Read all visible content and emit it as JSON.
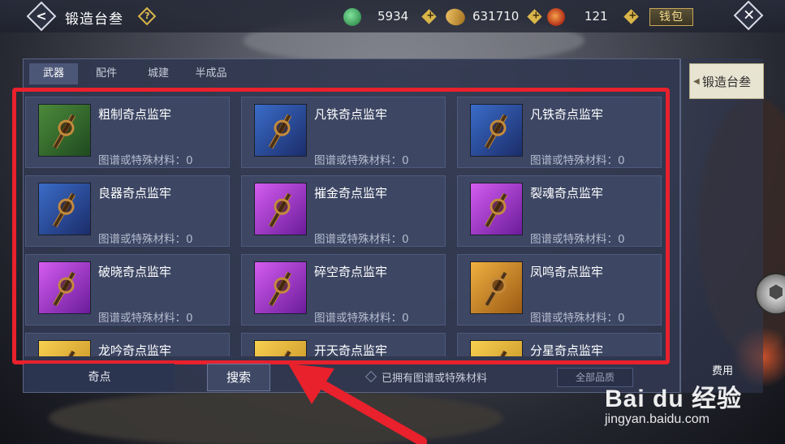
{
  "header": {
    "title": "锻造台叁",
    "help_glyph": "?",
    "back_glyph": "<",
    "close_glyph": "✕",
    "resources": [
      {
        "name": "jade-icon",
        "value": "5934"
      },
      {
        "name": "gold-icon",
        "value": "631710"
      },
      {
        "name": "flame-icon",
        "value": "121"
      }
    ],
    "plus_glyph": "+",
    "wallet_label": "钱包"
  },
  "tabs": [
    {
      "label": "武器",
      "active": true
    },
    {
      "label": "配件",
      "active": false
    },
    {
      "label": "城建",
      "active": false
    },
    {
      "label": "半成品",
      "active": false
    }
  ],
  "items": [
    {
      "name": "粗制奇点监牢",
      "material": "图谱或特殊材料：0",
      "quality": "green"
    },
    {
      "name": "凡铁奇点监牢",
      "material": "图谱或特殊材料：0",
      "quality": "blue"
    },
    {
      "name": "凡铁奇点监牢",
      "material": "图谱或特殊材料：0",
      "quality": "blue"
    },
    {
      "name": "良器奇点监牢",
      "material": "图谱或特殊材料：0",
      "quality": "blue"
    },
    {
      "name": "摧金奇点监牢",
      "material": "图谱或特殊材料：0",
      "quality": "purple"
    },
    {
      "name": "裂魂奇点监牢",
      "material": "图谱或特殊材料：0",
      "quality": "purple"
    },
    {
      "name": "破晓奇点监牢",
      "material": "图谱或特殊材料：0",
      "quality": "purple"
    },
    {
      "name": "碎空奇点监牢",
      "material": "图谱或特殊材料：0",
      "quality": "purple"
    },
    {
      "name": "凤鸣奇点监牢",
      "material": "图谱或特殊材料：0",
      "quality": "orange"
    },
    {
      "name": "龙吟奇点监牢",
      "material": "",
      "quality": "yellow"
    },
    {
      "name": "开天奇点监牢",
      "material": "",
      "quality": "yellow"
    },
    {
      "name": "分星奇点监牢",
      "material": "",
      "quality": "yellow"
    }
  ],
  "footer": {
    "category_label": "奇点",
    "search_label": "搜索",
    "owned_filter_label": "已拥有图谱或特殊材料",
    "quality_select_value": "全部品质",
    "cost_label": "费用"
  },
  "side": {
    "tab_label": "锻造台叁",
    "tab_arrow": "◀",
    "gear_glyph": "⬢"
  },
  "watermark": {
    "logo": "Bai du 经验",
    "url": "jingyan.baidu.com"
  },
  "colors": {
    "highlight_box": "#e8212c",
    "annotation_arrow": "#e8212c",
    "wallet_accent": "#c9a85a"
  }
}
